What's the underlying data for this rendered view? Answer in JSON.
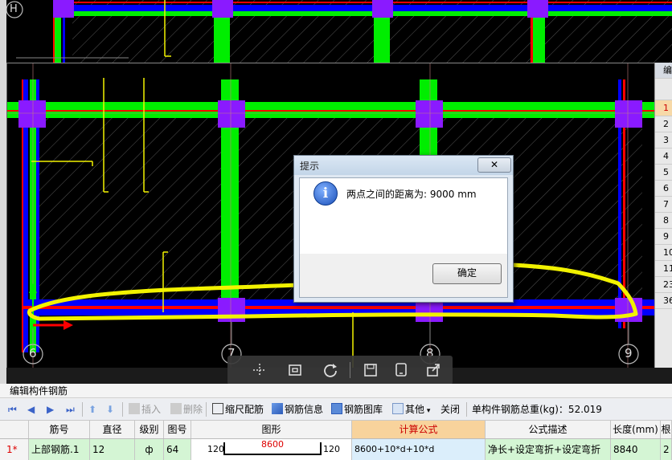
{
  "cad": {
    "top_axis_label": "H",
    "axis_labels": [
      "6",
      "7",
      "8",
      "9"
    ]
  },
  "right_panel": {
    "header": "编",
    "rows": [
      "1",
      "2",
      "3",
      "4",
      "5",
      "6",
      "7",
      "8",
      "9",
      "10",
      "11",
      "23",
      "36"
    ],
    "selected_row": "1"
  },
  "float_toolbar": {
    "icons": [
      "pan-icon",
      "fit-view-icon",
      "rotate-icon",
      "save-icon",
      "screen-icon",
      "export-icon"
    ]
  },
  "dialog": {
    "title": "提示",
    "close_label": "✕",
    "message": "两点之间的距离为: 9000 mm",
    "ok_label": "确定"
  },
  "panel": {
    "title": "编辑构件钢筋"
  },
  "toolbar": {
    "insert": "插入",
    "delete": "删除",
    "scale": "缩尺配筋",
    "rebar_info": "钢筋信息",
    "rebar_lib": "钢筋图库",
    "other": "其他",
    "close": "关闭",
    "total_weight": "单构件钢筋总重(kg)：52.019"
  },
  "grid": {
    "headers": [
      "筋号",
      "直径(mm)",
      "级别",
      "图号",
      "图形",
      "计算公式",
      "公式描述",
      "长度(mm)",
      "根"
    ],
    "row": {
      "index": "1*",
      "name": "上部钢筋.1",
      "diameter": "12",
      "grade": "ф",
      "figure_no": "64",
      "shape_left": "120",
      "shape_mid": "8600",
      "shape_right": "120",
      "formula": "8600+10*d+10*d",
      "description": "净长+设定弯折+设定弯折",
      "length": "8840",
      "count": "2"
    }
  },
  "colors": {
    "beam_green": "#00ee00",
    "column_purple": "#8a1aff",
    "annotation_yellow": "#f2f200",
    "line_blue": "#0000ff",
    "line_red": "#ff0000",
    "formula_header": "#f8d39c"
  }
}
